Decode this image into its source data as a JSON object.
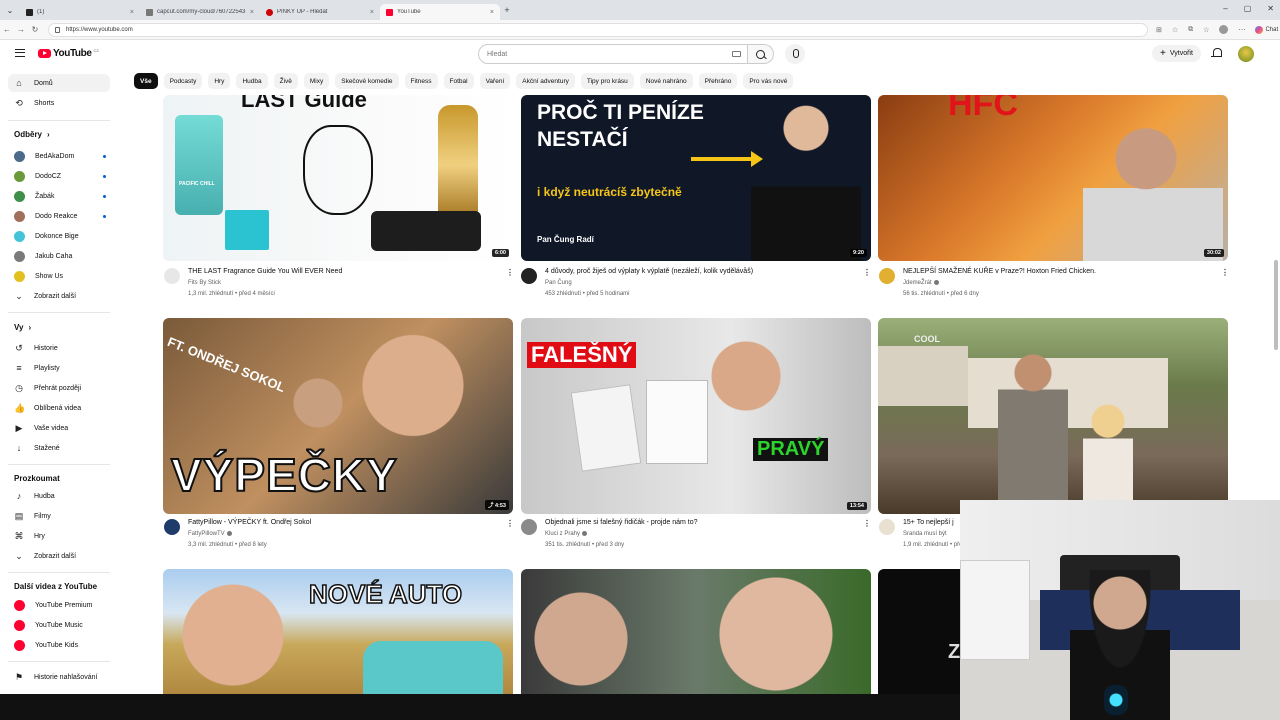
{
  "browser": {
    "menu_glyph": "⌄",
    "tabs": [
      {
        "title": "(1)",
        "icon": "ds",
        "active": false
      },
      {
        "title": "capcut.com/my-cloud/760722543...",
        "icon": "generic",
        "active": false
      },
      {
        "title": "PINKY UP - Hledat",
        "icon": "seznam",
        "active": false
      },
      {
        "title": "YouTube",
        "icon": "yt",
        "active": true
      }
    ],
    "new_tab": "+",
    "close_glyph": "×",
    "url": "https://www.youtube.com",
    "chat_label": "Chat",
    "window_controls": [
      "–",
      "▢",
      "✕"
    ]
  },
  "header": {
    "logo_text": "YouTube",
    "country_code": "CZ",
    "search_placeholder": "Hledat",
    "create_label": "Vytvořit",
    "create_plus": "+"
  },
  "sidebar": {
    "main": [
      {
        "label": "Domů",
        "icon": "home-icon",
        "glyph": "⌂",
        "active": true
      },
      {
        "label": "Shorts",
        "icon": "shorts-icon",
        "glyph": "⟲",
        "active": false
      }
    ],
    "subs_heading": "Odběry",
    "subs": [
      {
        "label": "BedAkaDom",
        "color": "#4a6b8a",
        "live": true
      },
      {
        "label": "DodoCZ",
        "color": "#6a9a3a",
        "live": true
      },
      {
        "label": "Žabák",
        "color": "#3f8f4a",
        "live": true
      },
      {
        "label": "Dodo Reakce",
        "color": "#a0705a",
        "live": true
      },
      {
        "label": "Dokonce Bige",
        "color": "#45c4d8",
        "live": false
      },
      {
        "label": "Jakub Caha",
        "color": "#7a7a7a",
        "live": false
      },
      {
        "label": "Show Us",
        "color": "#e2c020",
        "live": false
      },
      {
        "label": "Zobrazit další",
        "color": "",
        "live": false
      }
    ],
    "you_heading": "Vy",
    "you": [
      {
        "label": "Historie",
        "icon": "history-icon",
        "glyph": "↺"
      },
      {
        "label": "Playlisty",
        "icon": "playlists-icon",
        "glyph": "≡"
      },
      {
        "label": "Přehrát později",
        "icon": "watch-later-icon",
        "glyph": "◷"
      },
      {
        "label": "Oblíbená videa",
        "icon": "liked-icon",
        "glyph": "👍"
      },
      {
        "label": "Vaše videa",
        "icon": "your-videos-icon",
        "glyph": "▶"
      },
      {
        "label": "Stažené",
        "icon": "downloads-icon",
        "glyph": "↓"
      }
    ],
    "explore_heading": "Prozkoumat",
    "explore": [
      {
        "label": "Hudba",
        "icon": "music-icon",
        "glyph": "♪"
      },
      {
        "label": "Filmy",
        "icon": "films-icon",
        "glyph": "▤"
      },
      {
        "label": "Hry",
        "icon": "gaming-icon",
        "glyph": "⌘"
      },
      {
        "label": "Zobrazit další",
        "icon": "chevron-down-icon",
        "glyph": "⌄"
      }
    ],
    "more_heading": "Další videa z YouTube",
    "more": [
      {
        "label": "YouTube Premium",
        "color": "#ff0033"
      },
      {
        "label": "YouTube Music",
        "color": "#ff0033"
      },
      {
        "label": "YouTube Kids",
        "color": "#ff0033"
      }
    ],
    "report": {
      "label": "Historie nahlašování",
      "glyph": "⚑"
    }
  },
  "chips": [
    "Vše",
    "Podcasty",
    "Hry",
    "Hudba",
    "Živě",
    "Mixy",
    "Skečové komedie",
    "Fitness",
    "Fotbal",
    "Vaření",
    "Akční adventury",
    "Tipy pro krásu",
    "Nové nahráno",
    "Přehráno",
    "Pro vás nové"
  ],
  "videos": [
    {
      "title": "THE LAST Fragrance Guide You Will EVER Need",
      "channel": "Fits By Stick",
      "stats": "1,3 mil. zhlédnutí • před 4 měsíci",
      "duration": "6:00",
      "thumb_text": "LAST Guide",
      "thumb_extra": "PACIFIC CHILL",
      "verified": false
    },
    {
      "title": "4 důvody, proč žiješ od výplaty k výplatě (nezáleží, kolik vydělávåš)",
      "channel": "Pan Čung",
      "stats": "453 zhlédnutí • před 5 hodinami",
      "duration": "9:20",
      "thumb_text": "PROČ TI PENÍZE NESTAČÍ",
      "thumb_sub": "i když neutrácíš zbytečně",
      "thumb_name": "Pan Čung Radí",
      "verified": false
    },
    {
      "title": "NEJLEPŠÍ SMAŽENÉ KUŘE v Praze?! Hoxton Fried Chicken.",
      "channel": "JdemeŽrát",
      "stats": "56 tis. zhlédnutí • před 6 dny",
      "duration": "30:02",
      "thumb_text": "HFC",
      "verified": true
    },
    {
      "title": "FattyPillow - VÝPEČKY ft. Ondřej Sokol",
      "channel": "FattyPillowTV",
      "stats": "3,3 mil. zhlédnutí • před 8 lety",
      "duration": "4:53",
      "thumb_text": "VÝPEČKY",
      "thumb_sub": "FT. ONDŘEJ SOKOL",
      "verified": true
    },
    {
      "title": "Objednali jsme si falešný řidičák - projde nám to?",
      "channel": "Kluci z Prahy",
      "stats": "351 tis. zhlédnutí • před 3 dny",
      "duration": "13:54",
      "thumb_text": "FALEŠNÝ",
      "thumb_sub": "PRAVÝ",
      "verified": true
    },
    {
      "title": "15+ To nejlepší j",
      "channel": "Sranda musí být",
      "stats": "1,9 mil. zhlédnutí • před",
      "duration": "",
      "thumb_text": "COOL",
      "verified": false
    },
    {
      "thumb_text": "NOVÉ AUTO"
    },
    {
      "thumb_text": ""
    },
    {
      "thumb_text": "Z"
    }
  ],
  "colors": {
    "yt_red": "#ff0033",
    "chip_active": "#0f0f0f"
  }
}
